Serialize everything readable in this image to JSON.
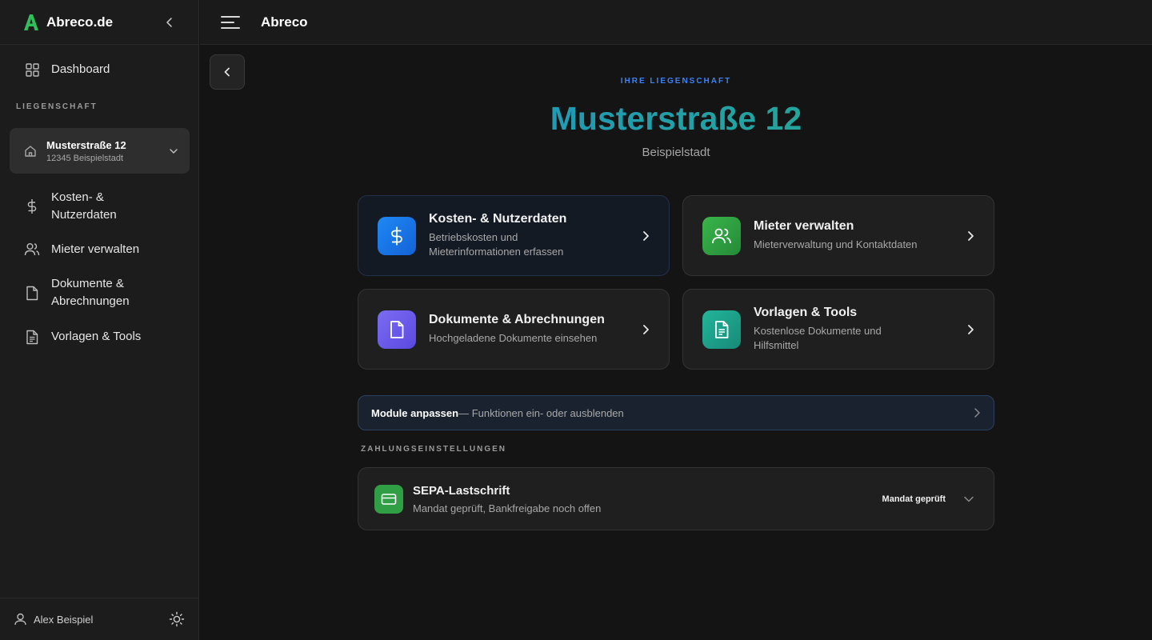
{
  "app": {
    "brand": "Abreco.de",
    "top_title": "Abreco"
  },
  "sidebar": {
    "dashboard": "Dashboard",
    "section_label": "LIEGENSCHAFT",
    "property": {
      "name": "Musterstraße 12",
      "address": "12345 Beispielstadt"
    },
    "items": [
      {
        "label": "Kosten- & Nutzerdaten",
        "icon": "dollar-icon"
      },
      {
        "label": "Mieter verwalten",
        "icon": "users-icon"
      },
      {
        "label": "Dokumente & Abrechnungen",
        "icon": "file-icon"
      },
      {
        "label": "Vorlagen & Tools",
        "icon": "file-text-icon"
      }
    ],
    "user": "Alex Beispiel"
  },
  "main": {
    "eyebrow": "IHRE LIEGENSCHAFT",
    "title": "Musterstraße 12",
    "subtitle": "Beispielstadt",
    "cards": [
      {
        "title": "Kosten- & Nutzerdaten",
        "desc": "Betriebskosten und Mieterinformationen erfassen",
        "color": "#1a6fe0"
      },
      {
        "title": "Mieter verwalten",
        "desc": "Mieterverwaltung und Kontaktdaten",
        "color": "#2f9e44"
      },
      {
        "title": "Dokumente & Abrechnungen",
        "desc": "Hochgeladene Dokumente einsehen",
        "color": "#6d5bea"
      },
      {
        "title": "Vorlagen & Tools",
        "desc": "Kostenlose Dokumente und Hilfsmittel",
        "color": "#1fa38a"
      }
    ],
    "modules": {
      "title": "Module anpassen",
      "desc": "— Funktionen ein- oder ausblenden"
    },
    "payment_label": "ZAHLUNGSEINSTELLUNGEN",
    "sepa": {
      "title": "SEPA-Lastschrift",
      "desc": "Mandat geprüft, Bankfreigabe noch offen",
      "status": "Mandat geprüft"
    }
  }
}
